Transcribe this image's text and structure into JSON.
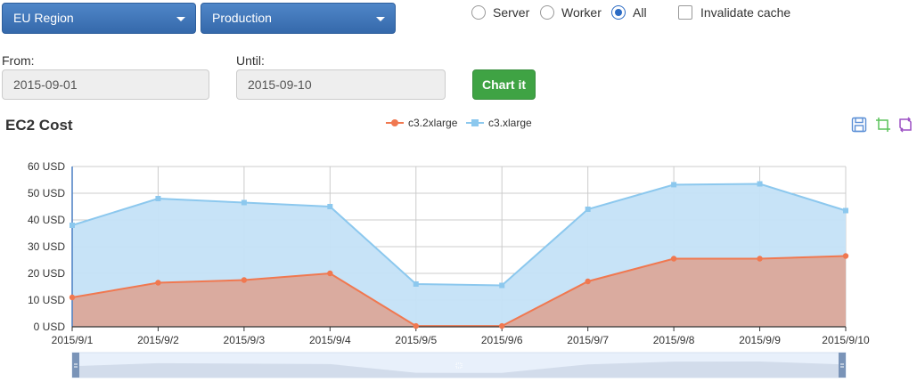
{
  "controls": {
    "region": "EU Region",
    "environment": "Production",
    "radios": [
      {
        "label": "Server",
        "checked": false
      },
      {
        "label": "Worker",
        "checked": false
      },
      {
        "label": "All",
        "checked": true
      }
    ],
    "invalidate_label": "Invalidate cache",
    "from_label": "From:",
    "from_value": "2015-09-01",
    "until_label": "Until:",
    "until_value": "2015-09-10",
    "chart_button": "Chart it"
  },
  "toolbox_icons": [
    "save-icon",
    "crop-icon",
    "restore-icon"
  ],
  "chart_data": {
    "type": "area",
    "title": "EC2 Cost",
    "categories": [
      "2015/9/1",
      "2015/9/2",
      "2015/9/3",
      "2015/9/4",
      "2015/9/5",
      "2015/9/6",
      "2015/9/7",
      "2015/9/8",
      "2015/9/9",
      "2015/9/10"
    ],
    "series": [
      {
        "name": "c3.2xlarge",
        "color": "#f07850",
        "fill": "#dba89a",
        "values": [
          11,
          16.5,
          17.5,
          20,
          0.3,
          0.3,
          17,
          25.5,
          25.5,
          26.5
        ]
      },
      {
        "name": "c3.xlarge",
        "color": "#8cc8ee",
        "fill": "#c4e2f7",
        "values": [
          38,
          48,
          46.5,
          45,
          16,
          15.5,
          44,
          53.2,
          53.5,
          43.5
        ]
      }
    ],
    "y_ticks": [
      "0 USD",
      "10 USD",
      "20 USD",
      "30 USD",
      "40 USD",
      "50 USD",
      "60 USD"
    ],
    "ylim": [
      0,
      60
    ],
    "grid": true,
    "legend_position": "top-center",
    "data_zoom": true
  }
}
